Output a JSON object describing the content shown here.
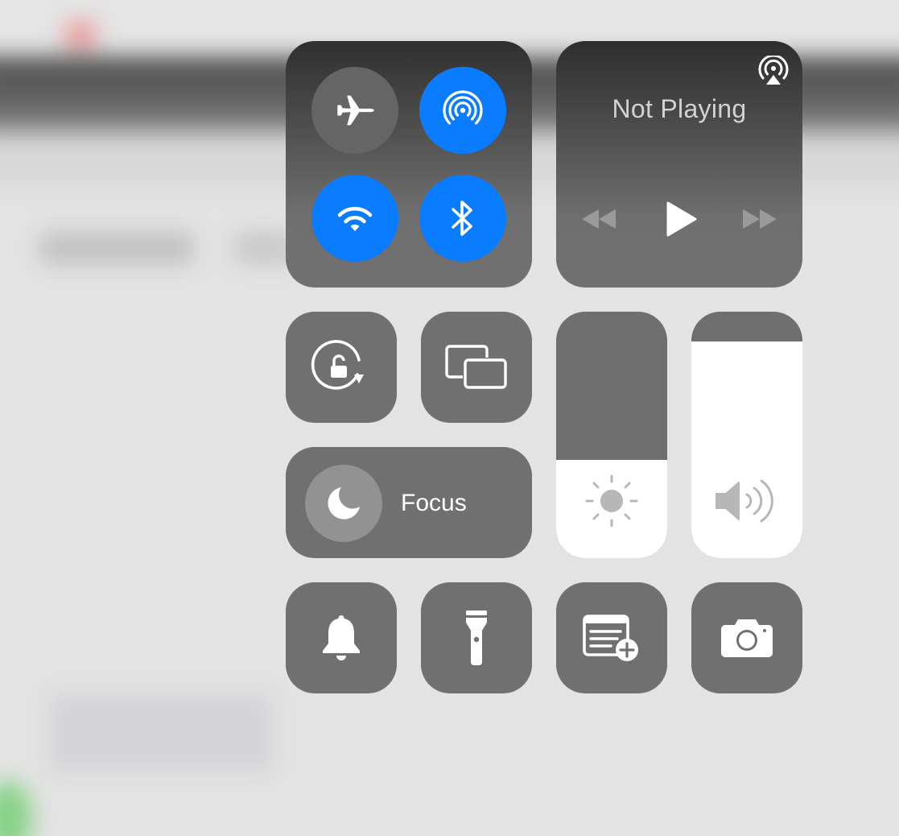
{
  "background": {
    "description": "blurred app behind control center"
  },
  "connectivity": {
    "airplane_mode": {
      "icon": "airplane-icon",
      "active": false
    },
    "airdrop": {
      "icon": "airdrop-icon",
      "active": true
    },
    "wifi": {
      "icon": "wifi-icon",
      "active": true
    },
    "bluetooth": {
      "icon": "bluetooth-icon",
      "active": true
    }
  },
  "media": {
    "status": "Not Playing",
    "airplay_icon": "airplay-icon",
    "rewind_icon": "rewind-icon",
    "play_icon": "play-icon",
    "forward_icon": "fast-forward-icon"
  },
  "controls": {
    "rotation_lock_icon": "rotation-lock-icon",
    "screen_mirroring_icon": "screen-mirroring-icon",
    "focus": {
      "label": "Focus",
      "icon": "moon-icon"
    },
    "brightness": {
      "icon": "sun-icon",
      "level": 0.4
    },
    "volume": {
      "icon": "speaker-icon",
      "level": 0.88
    },
    "silent_mode_icon": "bell-icon",
    "flashlight_icon": "flashlight-icon",
    "quick_note_icon": "quick-note-icon",
    "camera_icon": "camera-icon"
  },
  "colors": {
    "accent_blue": "#0a7cff",
    "tile_grey": "#707070",
    "inactive_circle": "#656565"
  }
}
